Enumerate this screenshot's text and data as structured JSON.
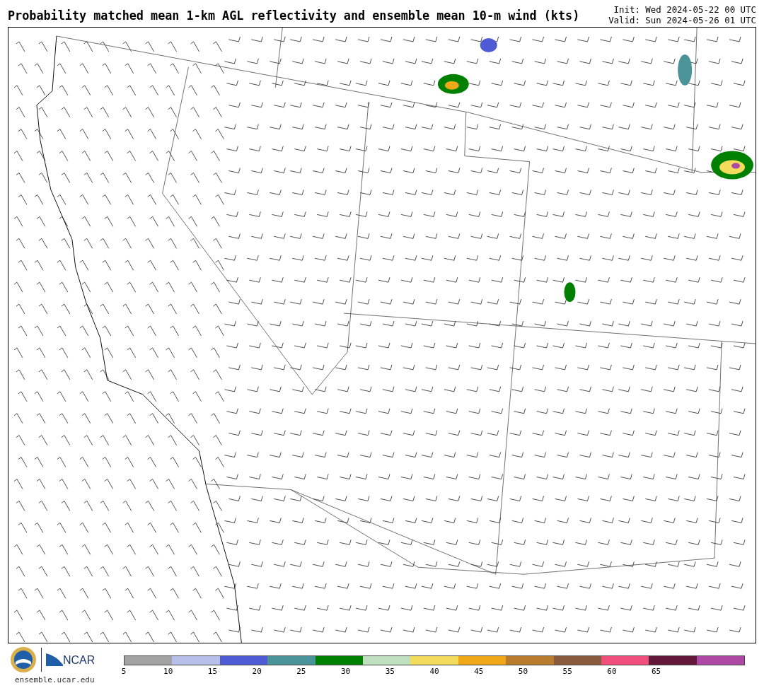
{
  "title": "Probability matched mean 1-km AGL reflectivity and ensemble mean 10-m wind (kts)",
  "times": [
    "Init: Wed 2024-05-22 00 UTC",
    "Valid: Sun 2024-05-26 01 UTC"
  ],
  "logos": {
    "ncar": "NCAR",
    "url": "ensemble.ucar.edu"
  },
  "colorbar": {
    "segments": [
      {
        "color": "#a3a3a3"
      },
      {
        "color": "#b7c0ea"
      },
      {
        "color": "#4f5bd5"
      },
      {
        "color": "#4a9398"
      },
      {
        "color": "#008000"
      },
      {
        "color": "#bfe0bf"
      },
      {
        "color": "#f3dc5c"
      },
      {
        "color": "#f0a818"
      },
      {
        "color": "#b87c2c"
      },
      {
        "color": "#8a5a3e"
      },
      {
        "color": "#ef4f7a"
      },
      {
        "color": "#621838"
      },
      {
        "color": "#ad48a4"
      }
    ],
    "ticks": [
      "5",
      "10",
      "15",
      "20",
      "25",
      "30",
      "35",
      "40",
      "45",
      "50",
      "55",
      "60",
      "65"
    ]
  }
}
